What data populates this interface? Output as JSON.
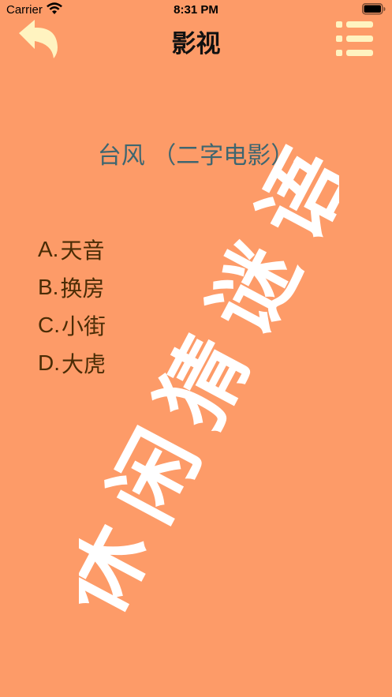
{
  "status_bar": {
    "carrier": "Carrier",
    "time": "8:31 PM"
  },
  "nav": {
    "title": "影视",
    "back_icon": "curved-back-arrow-icon",
    "menu_icon": "list-menu-icon",
    "icon_color": "#FFF3C0"
  },
  "watermark": {
    "text": "休闲猜谜语"
  },
  "question": {
    "text": "台风 （二字电影）"
  },
  "options": [
    {
      "letter": "A.",
      "text": "天音"
    },
    {
      "letter": "B.",
      "text": "换房"
    },
    {
      "letter": "C.",
      "text": "小街"
    },
    {
      "letter": "D.",
      "text": "大虎"
    }
  ],
  "colors": {
    "background": "#FD9B68",
    "question_text": "#3E6670",
    "option_text": "#4A2C05",
    "watermark": "#FFFFFF"
  }
}
